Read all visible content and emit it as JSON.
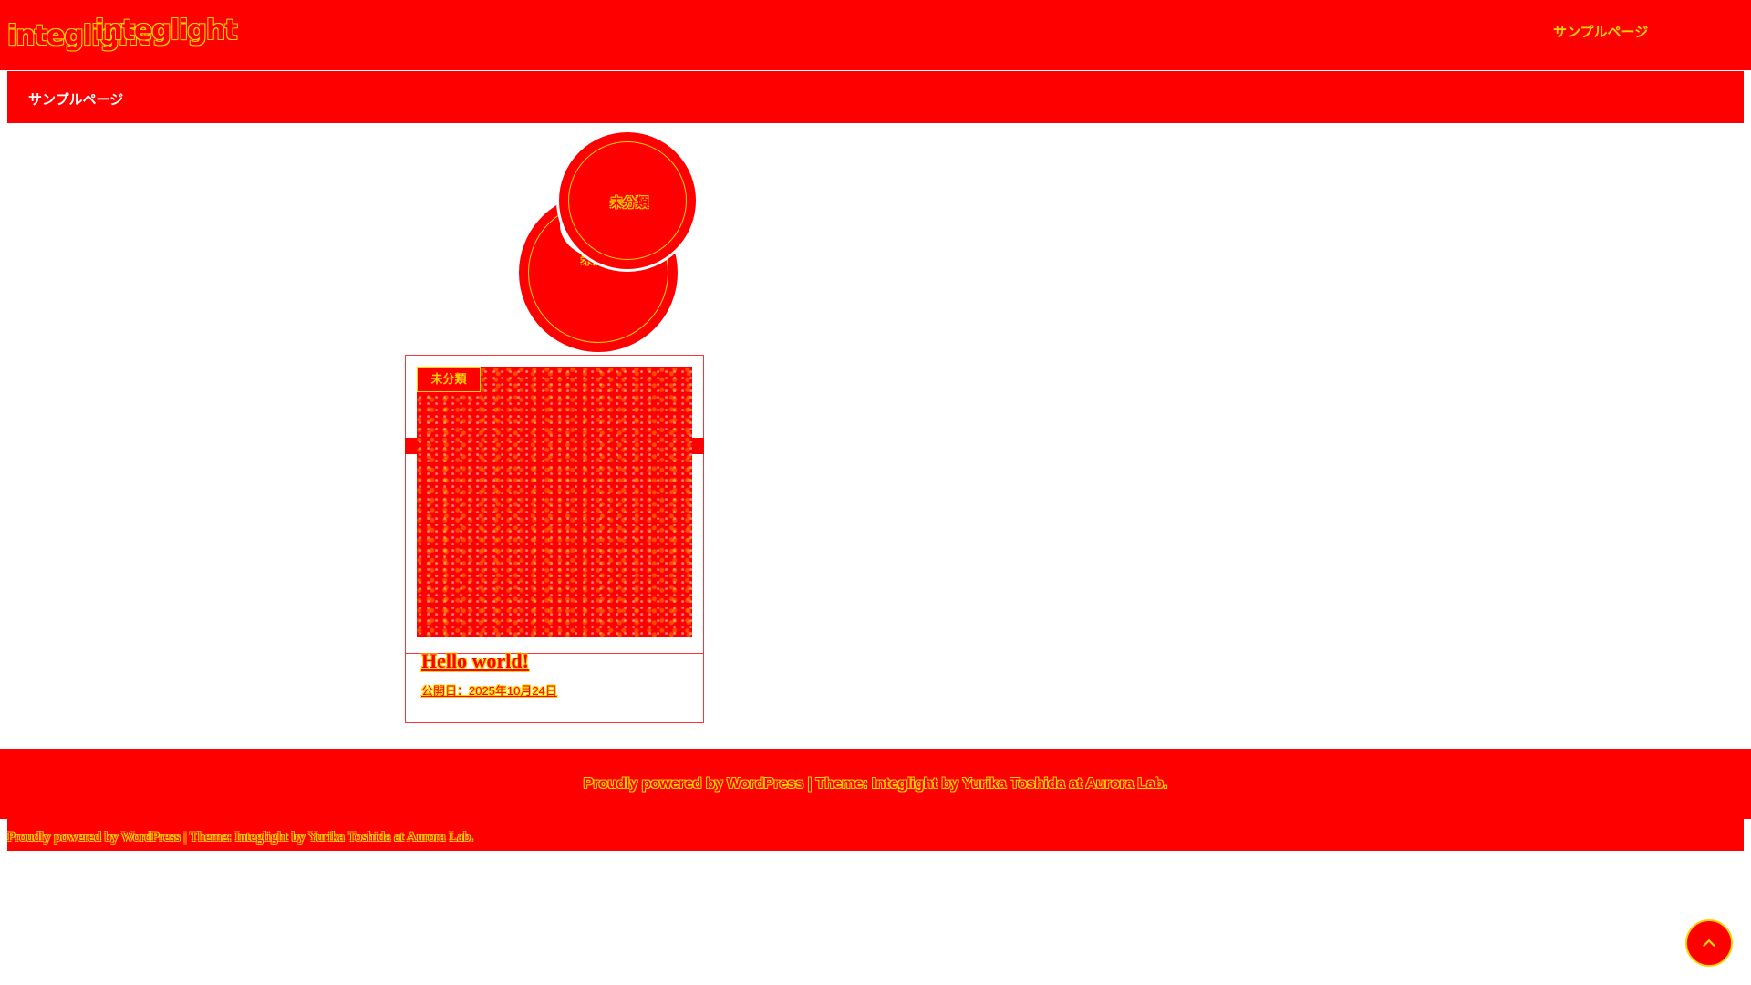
{
  "header": {
    "site_title": "integlight",
    "nav_link": "サンプルページ"
  },
  "sub_nav": {
    "link": "サンプルページ"
  },
  "categories": [
    {
      "label": "未分類"
    },
    {
      "label": "未分類"
    }
  ],
  "post": {
    "category": "未分類",
    "title": "Hello world!",
    "date": "公開日：2025年10月24日"
  },
  "footer": {
    "credit": "Proudly powered by WordPress | Theme: Integlight by Yurika Toshida at Aurora Lab.",
    "bar_credit": "Proudly powered by WordPress | Theme: Integlight by Yurika Toshida at Aurora Lab."
  },
  "icons": {
    "back_to_top": "arrow-up-icon"
  },
  "colors": {
    "primary": "#ff0000",
    "accent": "#ffd400",
    "background": "#ffffff"
  }
}
